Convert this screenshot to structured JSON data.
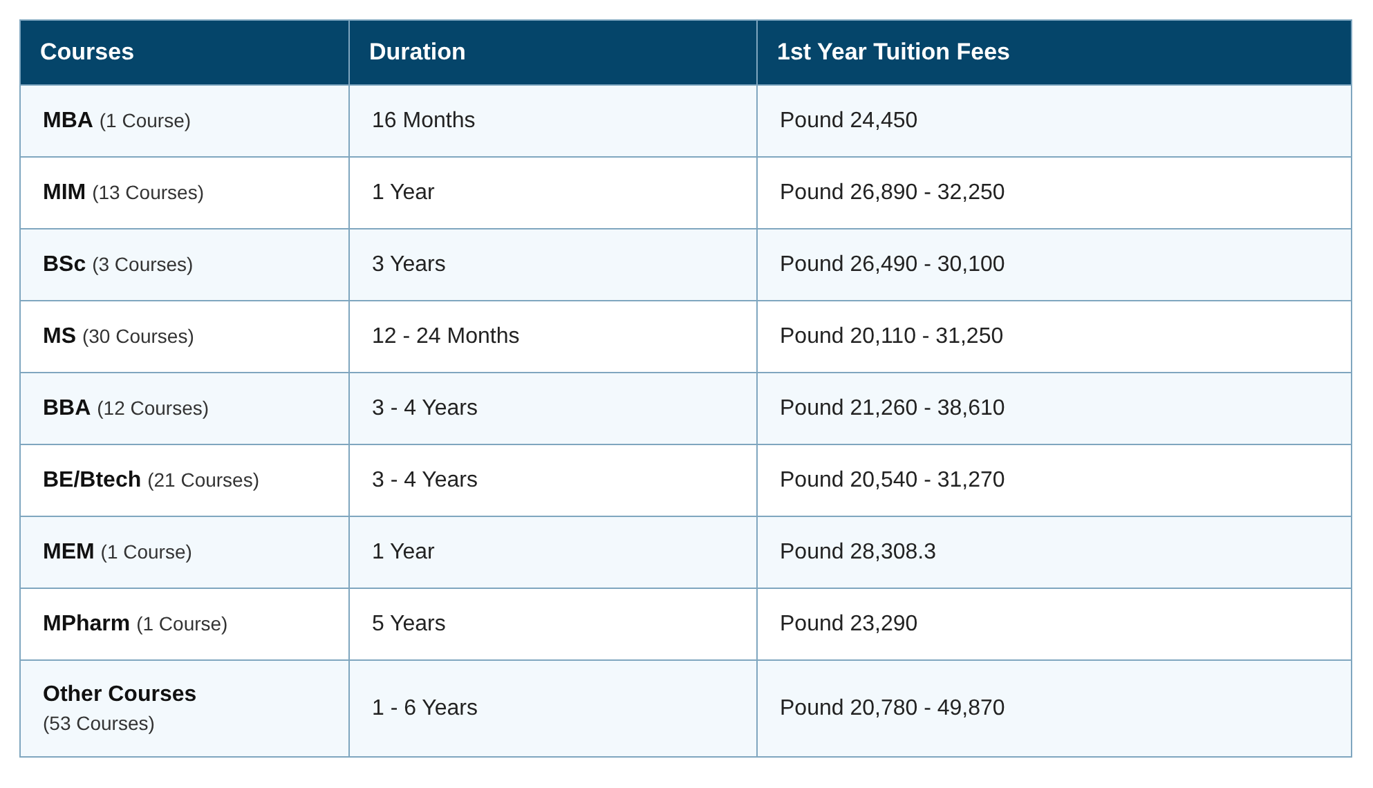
{
  "table": {
    "columns": [
      "Courses",
      "Duration",
      "1st Year Tuition Fees"
    ],
    "rows": [
      {
        "course": "MBA",
        "count": "(1 Course)",
        "kind": "inline",
        "duration": "16 Months",
        "fees": "Pound 24,450"
      },
      {
        "course": "MIM",
        "count": "(13 Courses)",
        "kind": "inline",
        "duration": "1 Year",
        "fees": "Pound 26,890 - 32,250"
      },
      {
        "course": "BSc",
        "count": "(3 Courses)",
        "kind": "inline",
        "duration": "3 Years",
        "fees": "Pound 26,490 - 30,100"
      },
      {
        "course": "MS",
        "count": "(30 Courses)",
        "kind": "inline",
        "duration": "12 - 24 Months",
        "fees": "Pound 20,110 - 31,250"
      },
      {
        "course": "BBA",
        "count": "(12 Courses)",
        "kind": "inline",
        "duration": "3 - 4 Years",
        "fees": "Pound 21,260 - 38,610"
      },
      {
        "course": "BE/Btech",
        "count": "(21 Courses)",
        "kind": "inline",
        "duration": "3 - 4 Years",
        "fees": "Pound 20,540 - 31,270"
      },
      {
        "course": "MEM",
        "count": "(1 Course)",
        "kind": "inline",
        "duration": "1 Year",
        "fees": "Pound 28,308.3"
      },
      {
        "course": "MPharm",
        "count": "(1 Course)",
        "kind": "inline",
        "duration": "5 Years",
        "fees": "Pound 23,290"
      },
      {
        "course": "Other Courses",
        "count": "(53 Courses)",
        "kind": "stacked",
        "duration": "1 - 6 Years",
        "fees": "Pound 20,780 - 49,870"
      }
    ]
  }
}
